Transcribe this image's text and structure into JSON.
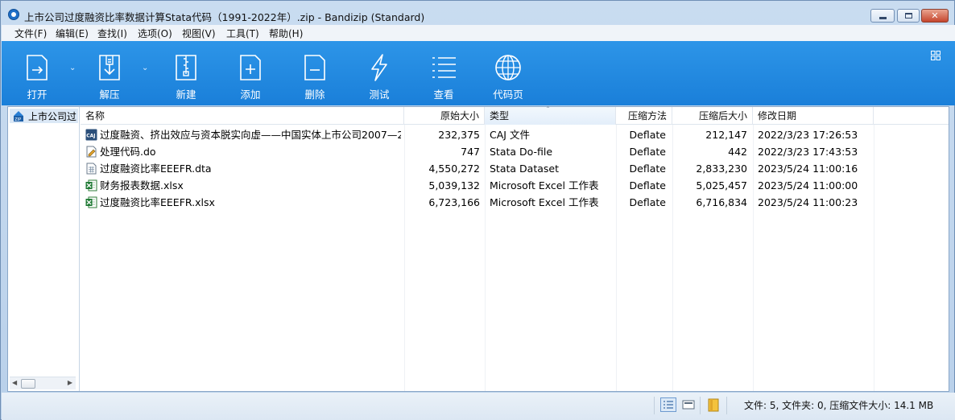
{
  "window": {
    "title": "上市公司过度融资比率数据计算Stata代码（1991-2022年）.zip - Bandizip (Standard)",
    "buttons": {
      "minimize": "",
      "maximize": "",
      "close": "✕"
    }
  },
  "menu": [
    {
      "label": "文件(F)"
    },
    {
      "label": "编辑(E)"
    },
    {
      "label": "查找(I)"
    },
    {
      "label": "选项(O)"
    },
    {
      "label": "视图(V)"
    },
    {
      "label": "工具(T)"
    },
    {
      "label": "帮助(H)"
    }
  ],
  "toolbar": {
    "accent": "#1f86dd",
    "open": "打开",
    "extract": "解压",
    "new": "新建",
    "add": "添加",
    "delete": "删除",
    "test": "测试",
    "view": "查看",
    "codepage": "代码页"
  },
  "tree": {
    "root_label": "上市公司过"
  },
  "columns": {
    "name": "名称",
    "size": "原始大小",
    "type": "类型",
    "method": "压缩方法",
    "packed": "压缩后大小",
    "modified": "修改日期"
  },
  "files": [
    {
      "name": "过度融资、挤出效应与资本脱实向虚——中国实体上市公司2007—2...",
      "size": "232,375",
      "type": "CAJ 文件",
      "method": "Deflate",
      "packed": "212,147",
      "modified": "2022/3/23 17:26:53",
      "icon": "caj-icon"
    },
    {
      "name": "处理代码.do",
      "size": "747",
      "type": "Stata Do-file",
      "method": "Deflate",
      "packed": "442",
      "modified": "2022/3/23 17:43:53",
      "icon": "do-file-icon"
    },
    {
      "name": "过度融资比率EEEFR.dta",
      "size": "4,550,272",
      "type": "Stata Dataset",
      "method": "Deflate",
      "packed": "2,833,230",
      "modified": "2023/5/24 11:00:16",
      "icon": "dta-file-icon"
    },
    {
      "name": "财务报表数据.xlsx",
      "size": "5,039,132",
      "type": "Microsoft Excel 工作表",
      "method": "Deflate",
      "packed": "5,025,457",
      "modified": "2023/5/24 11:00:00",
      "icon": "excel-icon"
    },
    {
      "name": "过度融资比率EEEFR.xlsx",
      "size": "6,723,166",
      "type": "Microsoft Excel 工作表",
      "method": "Deflate",
      "packed": "6,716,834",
      "modified": "2023/5/24 11:00:23",
      "icon": "excel-icon"
    }
  ],
  "status": {
    "summary": "文件: 5, 文件夹: 0, 压缩文件大小: 14.1 MB"
  }
}
